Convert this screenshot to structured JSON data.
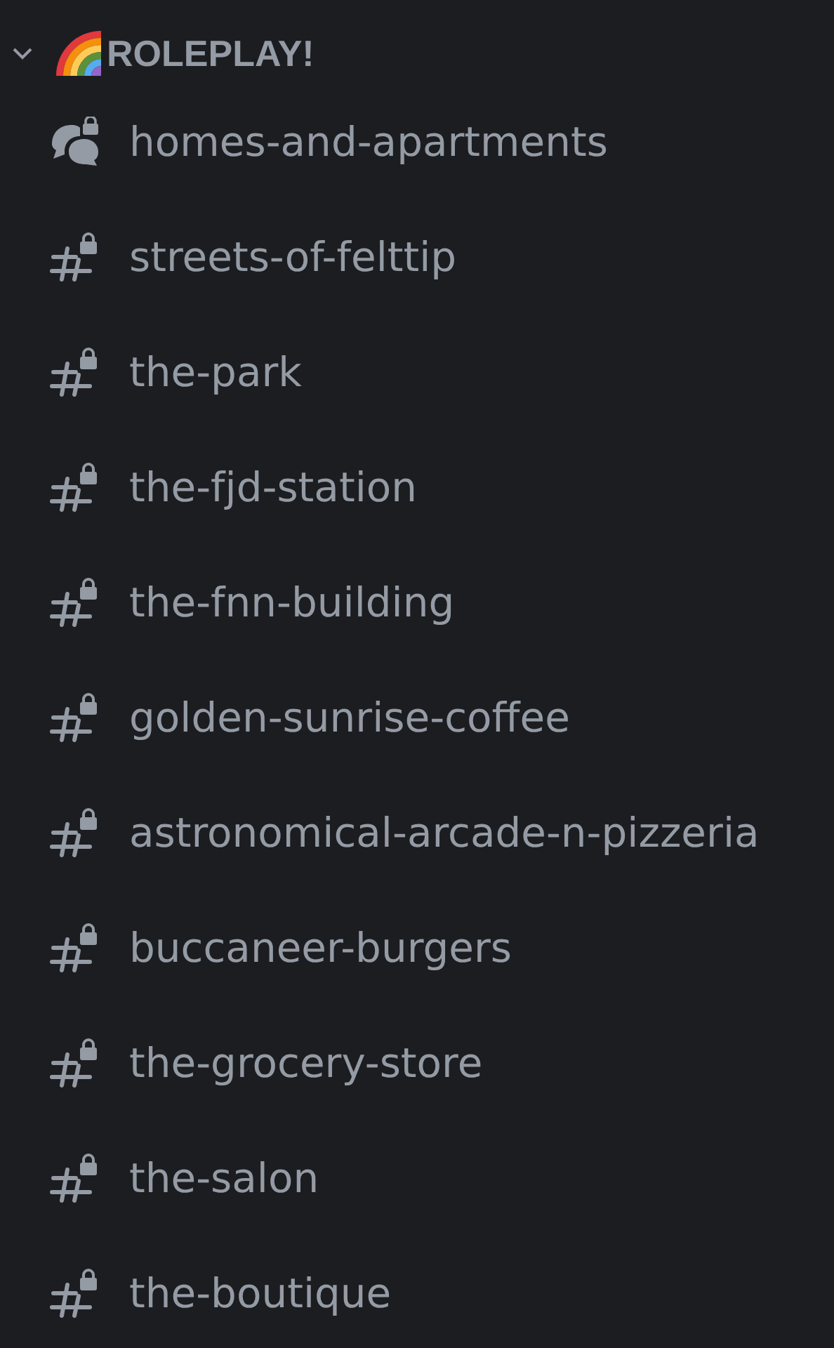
{
  "category": {
    "name": "ROLEPLAY!",
    "expanded": true
  },
  "channels": [
    {
      "kind": "forum",
      "name": "homes-and-apartments"
    },
    {
      "kind": "text",
      "name": "streets-of-felttip"
    },
    {
      "kind": "text",
      "name": "the-park"
    },
    {
      "kind": "text",
      "name": "the-fjd-station"
    },
    {
      "kind": "text",
      "name": "the-fnn-building"
    },
    {
      "kind": "text",
      "name": "golden-sunrise-coffee"
    },
    {
      "kind": "text",
      "name": "astronomical-arcade-n-pizzeria"
    },
    {
      "kind": "text",
      "name": "buccaneer-burgers"
    },
    {
      "kind": "text",
      "name": "the-grocery-store"
    },
    {
      "kind": "text",
      "name": "the-salon"
    },
    {
      "kind": "text",
      "name": "the-boutique"
    }
  ]
}
